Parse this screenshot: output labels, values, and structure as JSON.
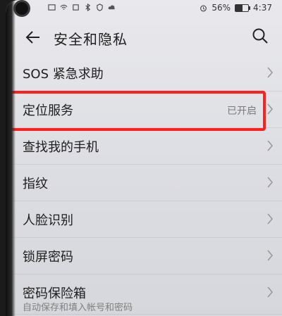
{
  "status_bar": {
    "battery": "56%",
    "time": "4:37",
    "battery_level": 0.56
  },
  "header": {
    "title": "安全和隐私",
    "back_icon": "arrow-left-icon",
    "search_icon": "search-icon"
  },
  "settings": [
    {
      "label": "SOS 紧急求助",
      "status": ""
    },
    {
      "label": "定位服务",
      "status": "已开启"
    },
    {
      "label": "查找我的手机",
      "status": ""
    },
    {
      "label": "指纹",
      "status": ""
    },
    {
      "label": "人脸识别",
      "status": ""
    },
    {
      "label": "锁屏密码",
      "status": ""
    },
    {
      "label": "密码保险箱",
      "status": "",
      "subtitle": "自动保存和填入帐号和密码"
    }
  ],
  "colors": {
    "highlight": "#ff1f1f"
  }
}
